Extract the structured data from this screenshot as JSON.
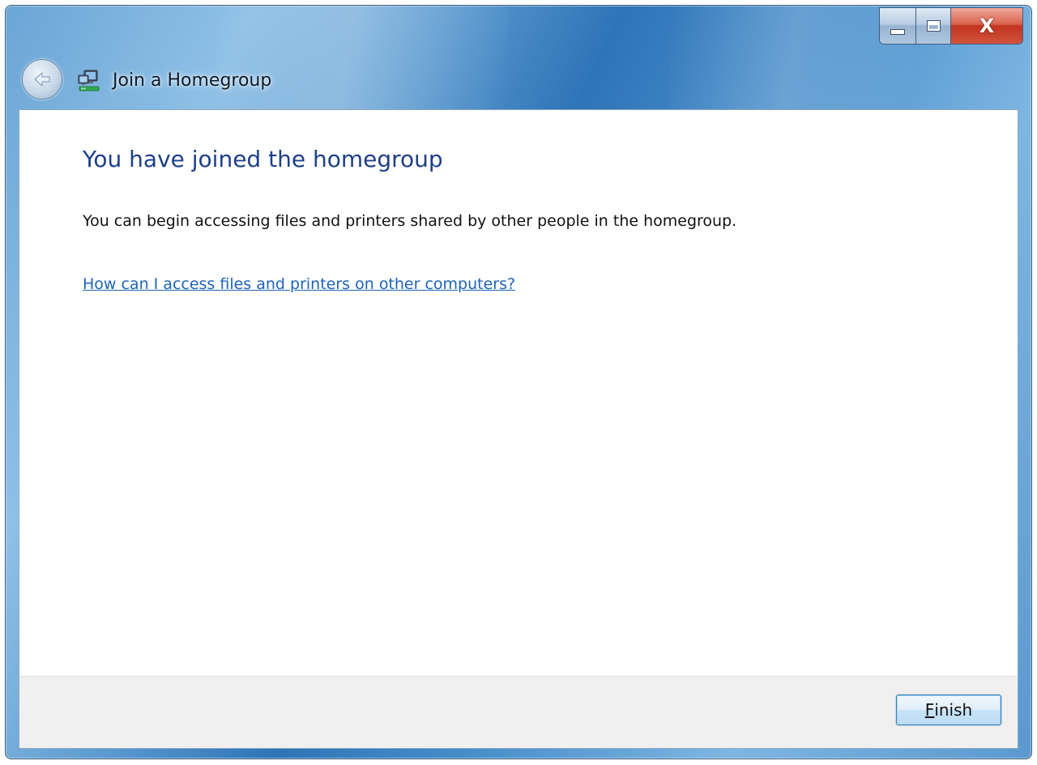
{
  "window": {
    "title": "Join a Homegroup",
    "title_icon": "homegroup-icon",
    "back_icon": "back-arrow-icon",
    "controls": {
      "minimize_icon": "minimize-icon",
      "maximize_icon": "maximize-icon",
      "close_icon": "close-icon",
      "close_glyph": "X"
    }
  },
  "main": {
    "heading": "You have joined the homegroup",
    "message": "You can begin accessing files and printers shared by other people in the homegroup.",
    "help_link": "How can I access files and printers on other computers?"
  },
  "footer": {
    "finish_access_key": "F",
    "finish_rest": "inish"
  },
  "colors": {
    "heading": "#1e3f8a",
    "link": "#1d63b8",
    "titlebar_accent": "#2f74b8",
    "close_button": "#c2341f"
  }
}
